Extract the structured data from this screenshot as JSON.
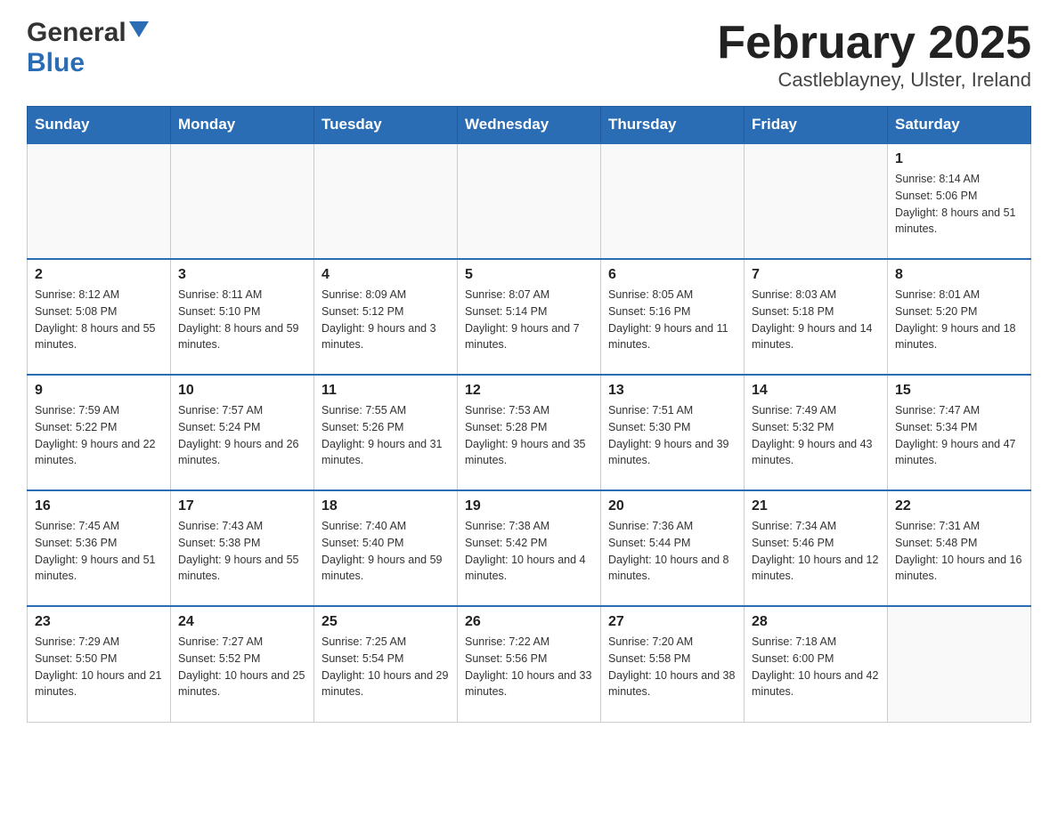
{
  "header": {
    "logo_general": "General",
    "logo_blue": "Blue",
    "title": "February 2025",
    "subtitle": "Castleblayney, Ulster, Ireland"
  },
  "days_of_week": [
    "Sunday",
    "Monday",
    "Tuesday",
    "Wednesday",
    "Thursday",
    "Friday",
    "Saturday"
  ],
  "weeks": [
    [
      {
        "day": "",
        "info": ""
      },
      {
        "day": "",
        "info": ""
      },
      {
        "day": "",
        "info": ""
      },
      {
        "day": "",
        "info": ""
      },
      {
        "day": "",
        "info": ""
      },
      {
        "day": "",
        "info": ""
      },
      {
        "day": "1",
        "info": "Sunrise: 8:14 AM\nSunset: 5:06 PM\nDaylight: 8 hours and 51 minutes."
      }
    ],
    [
      {
        "day": "2",
        "info": "Sunrise: 8:12 AM\nSunset: 5:08 PM\nDaylight: 8 hours and 55 minutes."
      },
      {
        "day": "3",
        "info": "Sunrise: 8:11 AM\nSunset: 5:10 PM\nDaylight: 8 hours and 59 minutes."
      },
      {
        "day": "4",
        "info": "Sunrise: 8:09 AM\nSunset: 5:12 PM\nDaylight: 9 hours and 3 minutes."
      },
      {
        "day": "5",
        "info": "Sunrise: 8:07 AM\nSunset: 5:14 PM\nDaylight: 9 hours and 7 minutes."
      },
      {
        "day": "6",
        "info": "Sunrise: 8:05 AM\nSunset: 5:16 PM\nDaylight: 9 hours and 11 minutes."
      },
      {
        "day": "7",
        "info": "Sunrise: 8:03 AM\nSunset: 5:18 PM\nDaylight: 9 hours and 14 minutes."
      },
      {
        "day": "8",
        "info": "Sunrise: 8:01 AM\nSunset: 5:20 PM\nDaylight: 9 hours and 18 minutes."
      }
    ],
    [
      {
        "day": "9",
        "info": "Sunrise: 7:59 AM\nSunset: 5:22 PM\nDaylight: 9 hours and 22 minutes."
      },
      {
        "day": "10",
        "info": "Sunrise: 7:57 AM\nSunset: 5:24 PM\nDaylight: 9 hours and 26 minutes."
      },
      {
        "day": "11",
        "info": "Sunrise: 7:55 AM\nSunset: 5:26 PM\nDaylight: 9 hours and 31 minutes."
      },
      {
        "day": "12",
        "info": "Sunrise: 7:53 AM\nSunset: 5:28 PM\nDaylight: 9 hours and 35 minutes."
      },
      {
        "day": "13",
        "info": "Sunrise: 7:51 AM\nSunset: 5:30 PM\nDaylight: 9 hours and 39 minutes."
      },
      {
        "day": "14",
        "info": "Sunrise: 7:49 AM\nSunset: 5:32 PM\nDaylight: 9 hours and 43 minutes."
      },
      {
        "day": "15",
        "info": "Sunrise: 7:47 AM\nSunset: 5:34 PM\nDaylight: 9 hours and 47 minutes."
      }
    ],
    [
      {
        "day": "16",
        "info": "Sunrise: 7:45 AM\nSunset: 5:36 PM\nDaylight: 9 hours and 51 minutes."
      },
      {
        "day": "17",
        "info": "Sunrise: 7:43 AM\nSunset: 5:38 PM\nDaylight: 9 hours and 55 minutes."
      },
      {
        "day": "18",
        "info": "Sunrise: 7:40 AM\nSunset: 5:40 PM\nDaylight: 9 hours and 59 minutes."
      },
      {
        "day": "19",
        "info": "Sunrise: 7:38 AM\nSunset: 5:42 PM\nDaylight: 10 hours and 4 minutes."
      },
      {
        "day": "20",
        "info": "Sunrise: 7:36 AM\nSunset: 5:44 PM\nDaylight: 10 hours and 8 minutes."
      },
      {
        "day": "21",
        "info": "Sunrise: 7:34 AM\nSunset: 5:46 PM\nDaylight: 10 hours and 12 minutes."
      },
      {
        "day": "22",
        "info": "Sunrise: 7:31 AM\nSunset: 5:48 PM\nDaylight: 10 hours and 16 minutes."
      }
    ],
    [
      {
        "day": "23",
        "info": "Sunrise: 7:29 AM\nSunset: 5:50 PM\nDaylight: 10 hours and 21 minutes."
      },
      {
        "day": "24",
        "info": "Sunrise: 7:27 AM\nSunset: 5:52 PM\nDaylight: 10 hours and 25 minutes."
      },
      {
        "day": "25",
        "info": "Sunrise: 7:25 AM\nSunset: 5:54 PM\nDaylight: 10 hours and 29 minutes."
      },
      {
        "day": "26",
        "info": "Sunrise: 7:22 AM\nSunset: 5:56 PM\nDaylight: 10 hours and 33 minutes."
      },
      {
        "day": "27",
        "info": "Sunrise: 7:20 AM\nSunset: 5:58 PM\nDaylight: 10 hours and 38 minutes."
      },
      {
        "day": "28",
        "info": "Sunrise: 7:18 AM\nSunset: 6:00 PM\nDaylight: 10 hours and 42 minutes."
      },
      {
        "day": "",
        "info": ""
      }
    ]
  ]
}
